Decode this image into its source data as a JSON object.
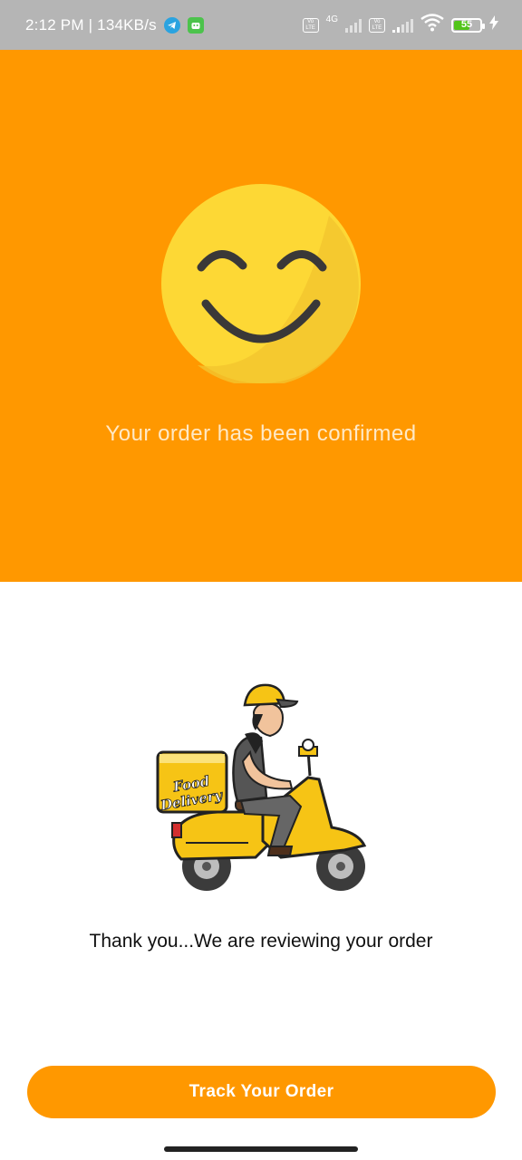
{
  "status_bar": {
    "time": "2:12 PM | 134KB/s",
    "notification_icons": [
      "telegram-icon",
      "android-robot-icon"
    ],
    "network_label": "4G",
    "battery_level": "55",
    "colors": {
      "background": "#b5b5b5",
      "battery_fill": "#52c41a"
    }
  },
  "hero": {
    "background_color": "#ff9800",
    "icon": "smiley-face-icon",
    "message": "Your order has been confirmed"
  },
  "illustration": {
    "icon": "food-delivery-scooter-icon",
    "box_text_line1": "Food",
    "box_text_line2": "Delivery"
  },
  "body": {
    "thank_you_message": "Thank you...We are reviewing your order"
  },
  "actions": {
    "track_button_label": "Track Your Order",
    "button_color": "#ff9800"
  }
}
